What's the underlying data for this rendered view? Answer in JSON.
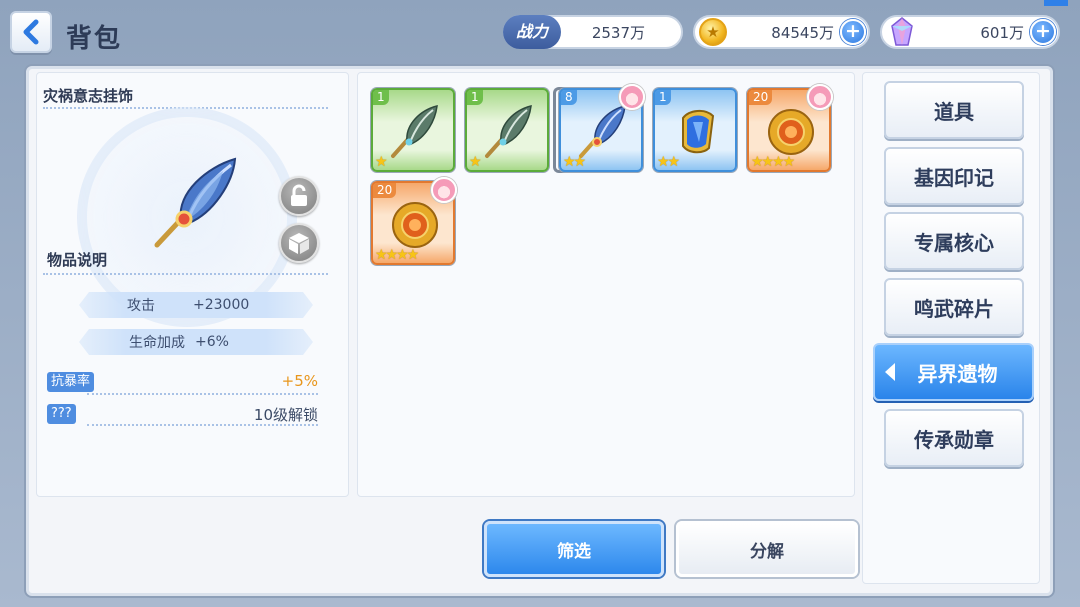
{
  "header": {
    "title": "背包",
    "power_label": "战力",
    "power_value": "2537万",
    "gold_value": "84545万",
    "gem_value": "601万",
    "plus_symbol": "+"
  },
  "detail": {
    "item_name": "灾祸意志挂饰",
    "section_title": "物品说明",
    "stats": [
      {
        "label": "攻击",
        "value": "+23000"
      },
      {
        "label": "生命加成",
        "value": "+6%"
      }
    ],
    "extra": [
      {
        "tag": "抗暴率",
        "value": "+5%",
        "value_color": "#e8961c"
      },
      {
        "tag": "???",
        "value": "10级解锁",
        "value_color": "#3b4660"
      }
    ],
    "lock_icon": "lock-icon",
    "box_icon": "cube-icon"
  },
  "inventory": {
    "items": [
      {
        "qty": "1",
        "stars": "★",
        "rarity": "green",
        "icon": "feather-icon",
        "avatar": false,
        "selected": false
      },
      {
        "qty": "1",
        "stars": "★",
        "rarity": "green",
        "icon": "feather-icon",
        "avatar": false,
        "selected": false
      },
      {
        "qty": "8",
        "stars": "★★",
        "rarity": "blue",
        "icon": "feather-icon",
        "avatar": true,
        "selected": true
      },
      {
        "qty": "1",
        "stars": "★★",
        "rarity": "blue",
        "icon": "blue-crystal-icon",
        "avatar": false,
        "selected": false
      },
      {
        "qty": "20",
        "stars": "★★★★",
        "rarity": "orange",
        "icon": "sun-amulet-icon",
        "avatar": true,
        "selected": false
      },
      {
        "qty": "20",
        "stars": "★★★★",
        "rarity": "orange",
        "icon": "sun-amulet-icon",
        "avatar": true,
        "selected": false
      }
    ]
  },
  "buttons": {
    "filter": "筛选",
    "decompose": "分解"
  },
  "tabs": [
    {
      "label": "道具",
      "active": false
    },
    {
      "label": "基因印记",
      "active": false
    },
    {
      "label": "专属核心",
      "active": false
    },
    {
      "label": "鸣武碎片",
      "active": false
    },
    {
      "label": "异界遗物",
      "active": true
    },
    {
      "label": "传承勋章",
      "active": false
    }
  ],
  "colors": {
    "accent_blue": "#2d88ec",
    "orange_value": "#e8961c",
    "tag_blue": "#4f8de0"
  }
}
